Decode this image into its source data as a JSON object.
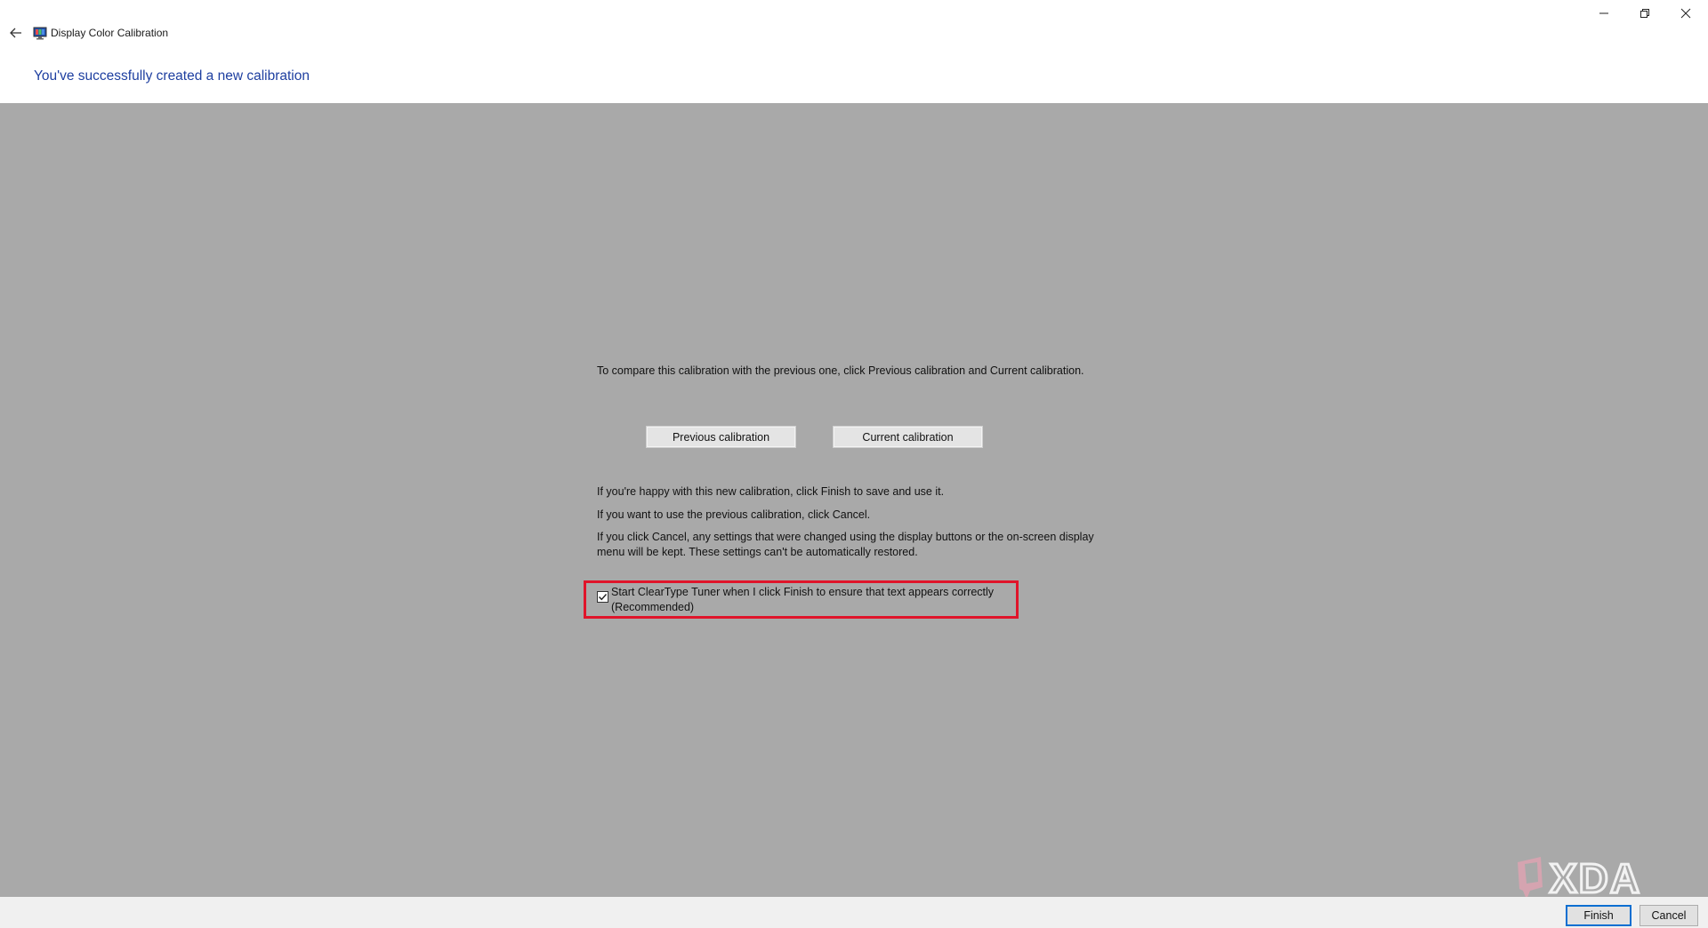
{
  "window": {
    "title": "Display Color Calibration",
    "icon": "display-calibration-icon",
    "controls": [
      "minimize-icon",
      "restore-icon",
      "close-icon"
    ]
  },
  "page": {
    "heading": "You've successfully created a new calibration"
  },
  "main": {
    "compare_text": "To compare this calibration with the previous one, click Previous calibration and Current calibration.",
    "previous_button": "Previous calibration",
    "current_button": "Current calibration",
    "happy_text": "If you're happy with this new calibration, click Finish to save and use it.",
    "previous_text": "If you want to use the previous calibration, click Cancel.",
    "cancel_note": "If you click Cancel, any settings that were changed using the display buttons or the on-screen display menu will be kept. These settings can't be automatically restored.",
    "cleartype_checkbox": {
      "label": "Start ClearType Tuner when I click Finish to ensure that text appears correctly (Recommended)",
      "checked": true
    }
  },
  "footer": {
    "finish": "Finish",
    "cancel": "Cancel"
  },
  "watermark": {
    "text": "XDA"
  },
  "colors": {
    "heading": "#1e3fa0",
    "content_background": "#a9a9a9",
    "highlight": "#e0142a",
    "primary_border": "#0a6fd1"
  }
}
